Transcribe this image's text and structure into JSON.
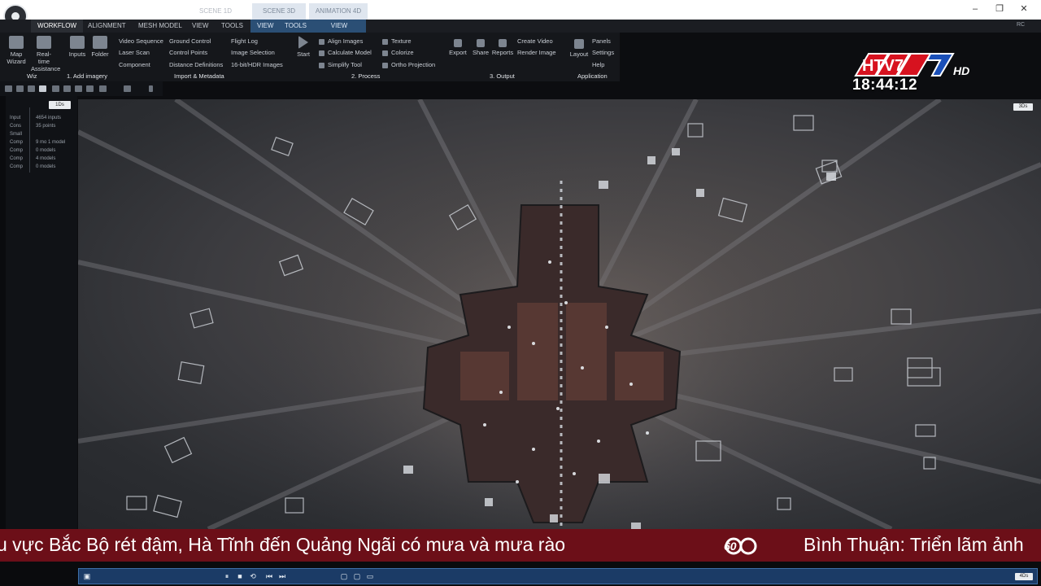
{
  "scene_tabs": [
    "SCENE 1D",
    "SCENE 3D",
    "ANIMATION 4D"
  ],
  "window_controls": {
    "minimize": "–",
    "maximize": "❐",
    "close": "✕"
  },
  "ribbon_tabs": [
    "WORKFLOW",
    "ALIGNMENT",
    "MESH MODEL",
    "VIEW",
    "TOOLS",
    "VIEW",
    "TOOLS",
    "VIEW"
  ],
  "ribbon_right": "RC",
  "ribbon": {
    "wizard": [
      {
        "label": "Map\nWizard",
        "icon": "map-wizard-icon"
      },
      {
        "label": "Real-time\nAssistance",
        "icon": "assistance-icon"
      }
    ],
    "add_imagery": [
      {
        "label": "Inputs",
        "icon": "inputs-icon"
      },
      {
        "label": "Folder",
        "icon": "folder-icon"
      }
    ],
    "import_col1": [
      "Video Sequence",
      "Laser Scan",
      "Component"
    ],
    "import_col2": [
      "Ground Control",
      "Control Points",
      "Distance Definitions"
    ],
    "import_col3": [
      "Flight Log",
      "Image Selection",
      "16-bit/HDR Images"
    ],
    "start": "Start",
    "process_col1": [
      "Align Images",
      "Calculate Model",
      "Simplify Tool"
    ],
    "process_col2": [
      "Texture",
      "Colorize",
      "Ortho Projection"
    ],
    "output_buttons": [
      "Export",
      "Share",
      "Reports"
    ],
    "output_col": [
      "Create Video",
      "Render Image"
    ],
    "layout": "Layout",
    "application_col": [
      "Panels",
      "Settings",
      "Help"
    ],
    "sections": [
      "Wiz",
      "1. Add imagery",
      "Import & Metadata",
      "2. Process",
      "3. Output",
      "Application"
    ]
  },
  "left_panel": {
    "badge": "1Ds",
    "rows": [
      {
        "key": "Input",
        "value": "4654 inputs"
      },
      {
        "key": "Cons",
        "value": "35 points"
      },
      {
        "key": "Small",
        "value": ""
      },
      {
        "key": "Comp",
        "value": "9 mo  1 model"
      },
      {
        "key": "Comp",
        "value": "0 models"
      },
      {
        "key": "Comp",
        "value": "4 models"
      },
      {
        "key": "Comp",
        "value": "0 models"
      }
    ]
  },
  "viewport": {
    "badge": "3Ds"
  },
  "channel": {
    "name": "HTV7",
    "suffix": "HD",
    "time": "18:44:12"
  },
  "ticker": {
    "headline_1": "u vực Bắc Bộ rét đậm, Hà Tĩnh đến Quảng Ngãi có mưa và mưa rào",
    "headline_2": "Bình Thuận: Triển lãm ảnh",
    "logo": "60"
  },
  "taskbar": {
    "badge": "4Ds",
    "play_pause": "⏸",
    "stop": "■",
    "loop": "⟲",
    "prev": "⏮",
    "next": "⏭"
  }
}
